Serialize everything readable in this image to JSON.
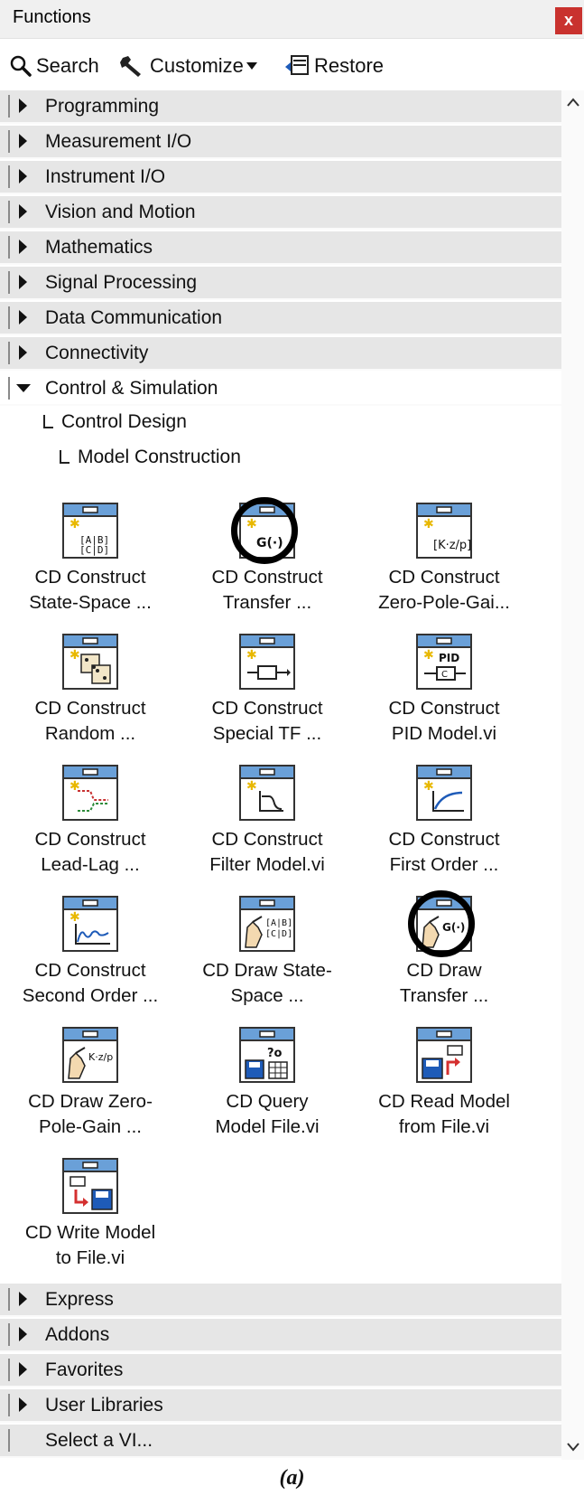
{
  "window": {
    "title": "Functions",
    "close_label": "x"
  },
  "toolbar": {
    "search_label": "Search",
    "customize_label": "Customize",
    "restore_label": "Restore"
  },
  "categories_top": [
    {
      "label": "Programming"
    },
    {
      "label": "Measurement I/O"
    },
    {
      "label": "Instrument I/O"
    },
    {
      "label": "Vision and Motion"
    },
    {
      "label": "Mathematics"
    },
    {
      "label": "Signal Processing"
    },
    {
      "label": "Data Communication"
    },
    {
      "label": "Connectivity"
    }
  ],
  "expanded": {
    "label": "Control & Simulation",
    "sub1": "Control Design",
    "sub2": "Model Construction"
  },
  "palette": [
    {
      "line1": "CD Construct",
      "line2": "State-Space ...",
      "icon": "state-space-icon"
    },
    {
      "line1": "CD Construct",
      "line2": "Transfer ...",
      "icon": "transfer-function-icon"
    },
    {
      "line1": "CD Construct",
      "line2": "Zero-Pole-Gai...",
      "icon": "zero-pole-gain-icon"
    },
    {
      "line1": "CD Construct",
      "line2": "Random ...",
      "icon": "dice-icon"
    },
    {
      "line1": "CD Construct",
      "line2": "Special TF ...",
      "icon": "special-tf-icon"
    },
    {
      "line1": "CD Construct",
      "line2": "PID Model.vi",
      "icon": "pid-icon"
    },
    {
      "line1": "CD Construct",
      "line2": "Lead-Lag ...",
      "icon": "lead-lag-icon"
    },
    {
      "line1": "CD Construct",
      "line2": "Filter Model.vi",
      "icon": "filter-icon"
    },
    {
      "line1": "CD Construct",
      "line2": "First Order ...",
      "icon": "first-order-icon"
    },
    {
      "line1": "CD Construct",
      "line2": "Second Order ...",
      "icon": "second-order-icon"
    },
    {
      "line1": "CD Draw State-",
      "line2": "Space ...",
      "icon": "draw-state-space-icon"
    },
    {
      "line1": "CD Draw",
      "line2": "Transfer ...",
      "icon": "draw-transfer-icon"
    },
    {
      "line1": "CD Draw Zero-",
      "line2": "Pole-Gain ...",
      "icon": "draw-zpk-icon"
    },
    {
      "line1": "CD Query",
      "line2": "Model File.vi",
      "icon": "query-file-icon"
    },
    {
      "line1": "CD Read Model",
      "line2": "from File.vi",
      "icon": "read-file-icon"
    },
    {
      "line1": "CD Write Model",
      "line2": "to File.vi",
      "icon": "write-file-icon"
    }
  ],
  "categories_bottom": [
    {
      "label": "Express"
    },
    {
      "label": "Addons"
    },
    {
      "label": "Favorites"
    },
    {
      "label": "User Libraries"
    },
    {
      "label": "Select a VI..."
    }
  ],
  "caption": "(a)"
}
